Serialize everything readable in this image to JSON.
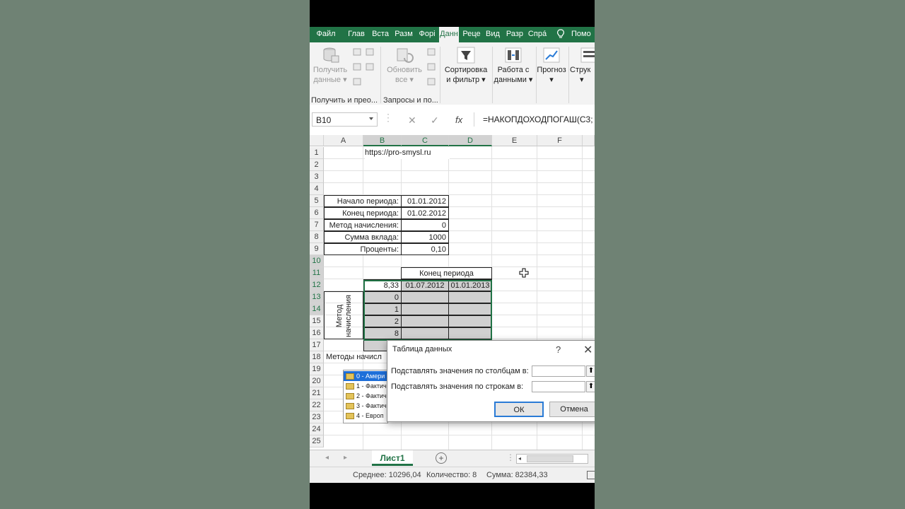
{
  "ribbon": {
    "tabs": [
      "Файл",
      "Глав",
      "Вста",
      "Разм",
      "Форі",
      "Данн",
      "Реце",
      "Вид",
      "Разр",
      "Спрá",
      "Помо"
    ],
    "active_tab": "Данн",
    "groups": {
      "get_data": {
        "btn1": "Получить",
        "btn2": "данные",
        "label": "Получить и прео..."
      },
      "queries": {
        "btn1": "Обновить",
        "btn2": "все",
        "label": "Запросы и по..."
      },
      "sort": {
        "line1": "Сортировка",
        "line2": "и фильтр"
      },
      "data_tools": {
        "line1": "Работа с",
        "line2": "данными"
      },
      "forecast": {
        "line1": "Прогноз"
      },
      "outline": {
        "line1": "Струк"
      }
    }
  },
  "formula_bar": {
    "name_box": "B10",
    "cancel_icon": "x-icon",
    "enter_icon": "check-icon",
    "fx_label": "fx",
    "formula": "=НАКОПДОХОДПОГАШ(С3;"
  },
  "grid": {
    "columns": [
      "A",
      "B",
      "C",
      "D",
      "E",
      "F"
    ],
    "rows": [
      "1",
      "2",
      "3",
      "4",
      "5",
      "6",
      "7",
      "8",
      "9",
      "10",
      "11",
      "12",
      "13",
      "14",
      "15",
      "16",
      "17",
      "18",
      "19",
      "20",
      "21",
      "22",
      "23",
      "24",
      "25"
    ],
    "url": "https://pro-smysl.ru",
    "params": [
      {
        "label": "Начало периода:",
        "value": "01.01.2012"
      },
      {
        "label": "Конец периода:",
        "value": "01.02.2012"
      },
      {
        "label": "Метод начисления:",
        "value": "0"
      },
      {
        "label": "Сумма вклада:",
        "value": "1000"
      },
      {
        "label": "Проценты:",
        "value": "0,10"
      }
    ],
    "period_header": "Конец периода",
    "corner_value": "8,33",
    "dates": [
      "01.07.2012",
      "01.01.2013"
    ],
    "methods": [
      "0",
      "1",
      "2",
      "8"
    ],
    "vertical_label_1": "Метод",
    "vertical_label_2": "начисления",
    "row16_text": "Методы начисл"
  },
  "listbox": {
    "items": [
      "0 - Амери",
      "1 - Фактич",
      "2 - Фактич",
      "3 - Фактич",
      "4 - Европ"
    ],
    "selected": 0
  },
  "dialog": {
    "title": "Таблица данных",
    "help": "?",
    "close": "✕",
    "row_input_label": "Подставлять значения по столбцам в:",
    "col_input_label": "Подставлять значения по строкам в:",
    "collapse_glyph": "⬆",
    "ok": "ОК",
    "cancel": "Отмена"
  },
  "sheetbar": {
    "sheet_name": "Лист1",
    "add": "+",
    "prev": "◂",
    "next": "▸",
    "scroll_left": "◂"
  },
  "status": {
    "average": "Среднее: 10296,04",
    "count": "Количество: 8",
    "sum": "Сумма: 82384,33"
  },
  "colors": {
    "excel_green": "#217346",
    "backdrop": "#6f8274",
    "selection_shade": "#d0d0d0",
    "ok_border": "#2a7bd6"
  }
}
